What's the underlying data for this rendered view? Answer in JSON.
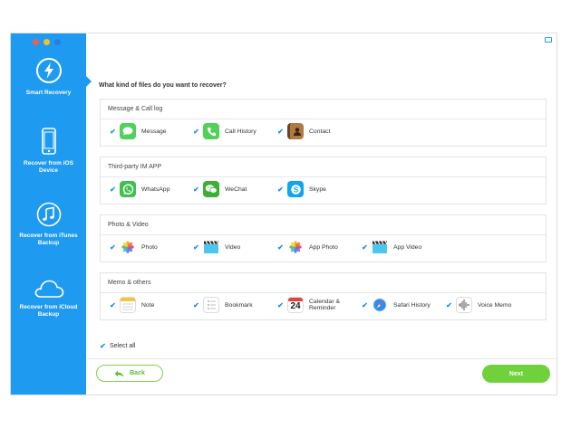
{
  "window": {
    "traffic_lights": [
      {
        "name": "close",
        "color": "#f25b56"
      },
      {
        "name": "minimize",
        "color": "#f6be2f"
      },
      {
        "name": "zoom",
        "color": "#2c7be5"
      }
    ]
  },
  "sidebar": {
    "color": "#1e9bf0",
    "items": [
      {
        "label": "Smart Recovery",
        "icon": "lightning-icon",
        "active": true
      },
      {
        "label": "Recover from iOS Device",
        "icon": "iphone-icon"
      },
      {
        "label": "Recover from iTunes Backup",
        "icon": "music-note-icon"
      },
      {
        "label": "Recover from iCloud Backup",
        "icon": "cloud-icon"
      }
    ]
  },
  "header": {
    "feedback_icon": "chat-bubble-icon"
  },
  "main": {
    "question": "What kind of files do you want to recover?",
    "groups": [
      {
        "title": "Message & Call log",
        "items": [
          {
            "label": "Message",
            "icon": "messages-app-icon",
            "checked": true
          },
          {
            "label": "Call History",
            "icon": "phone-app-icon",
            "checked": true
          },
          {
            "label": "Contact",
            "icon": "contacts-app-icon",
            "checked": true
          }
        ]
      },
      {
        "title": "Third-party IM APP",
        "items": [
          {
            "label": "WhatsApp",
            "icon": "whatsapp-icon",
            "checked": true
          },
          {
            "label": "WeChat",
            "icon": "wechat-icon",
            "checked": true
          },
          {
            "label": "Skype",
            "icon": "skype-icon",
            "checked": true
          }
        ]
      },
      {
        "title": "Photo & Video",
        "items": [
          {
            "label": "Photo",
            "icon": "photos-app-icon",
            "checked": true
          },
          {
            "label": "Video",
            "icon": "clapperboard-icon",
            "checked": true
          },
          {
            "label": "App Photo",
            "icon": "photos-app-icon",
            "checked": true
          },
          {
            "label": "App Video",
            "icon": "clapperboard-icon",
            "checked": true
          }
        ]
      },
      {
        "title": "Memo & others",
        "items": [
          {
            "label": "Note",
            "icon": "notes-app-icon",
            "checked": true
          },
          {
            "label": "Bookmark",
            "icon": "bookmark-icon",
            "checked": true
          },
          {
            "label": "Calendar & Reminder",
            "icon": "calendar-icon",
            "calendar_day": "24",
            "checked": true
          },
          {
            "label": "Safari History",
            "icon": "safari-icon",
            "checked": true
          },
          {
            "label": "Voice Memo",
            "icon": "voice-memo-icon",
            "checked": true
          }
        ]
      }
    ],
    "select_all": {
      "label": "Select all",
      "checked": true
    }
  },
  "footer": {
    "back_label": "Back",
    "next_label": "Next",
    "accent": "#6fd13c"
  }
}
